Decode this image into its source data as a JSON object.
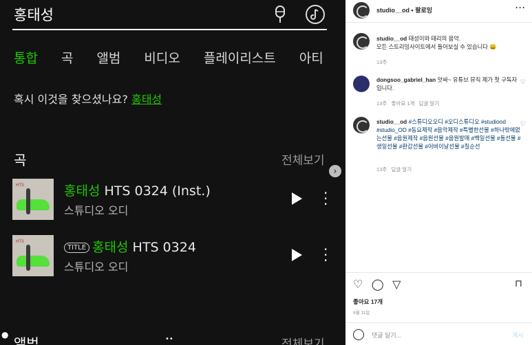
{
  "search": {
    "query": "홍태성"
  },
  "tabs": [
    "통합",
    "곡",
    "앨범",
    "비디오",
    "플레이리스트",
    "아티"
  ],
  "suggestion": {
    "prefix": "혹시 이것을 찾으셨나요?",
    "link": "홍태성"
  },
  "songs_section": {
    "title": "곡",
    "see_all": "전체보기"
  },
  "songs": [
    {
      "badge": "",
      "title_hl": "홍태성",
      "title_rest": " HTS 0324 (Inst.)",
      "artist": "스튜디오 오디"
    },
    {
      "badge": "TITLE",
      "title_hl": "홍태성",
      "title_rest": " HTS 0324",
      "artist": "스튜디오 오디"
    }
  ],
  "albums_section": {
    "title": "앨범",
    "see_all": "전체보기"
  },
  "instagram": {
    "header": {
      "username": "studio__od",
      "dot": "•",
      "follow": "팔로잉",
      "more": "···"
    },
    "caption": {
      "username": "studio__od",
      "text": "태성이와 태리의 음악.",
      "text2": "모든 스트리밍사이트에서 들어보실 수 있습니다 😀",
      "time": "13주"
    },
    "comments": [
      {
        "username": "dongsoo_gabriel_han",
        "text": "앗싸~ 유튜브 뮤직 제가 첫 구독자입니다.",
        "time": "13주",
        "likes": "좋아요 1개",
        "reply": "답글 달기"
      },
      {
        "username": "studio__od",
        "text": "#스튜디오오디 #오디스튜디오 #studiood #studio_OD #동요제작 #음악제작 #특별한선물 #하나밖에없는선물 #음원제작 #음원선물 #음원발매 #백일선물 #돌선물 #생일선물 #환갑선물 #어버이날선물 #칠순선",
        "time": "13주",
        "reply": "답글 달기"
      }
    ],
    "likes": "좋아요 17개",
    "date": "8월 11일",
    "add_comment_placeholder": "댓글 달기...",
    "post_label": "게시"
  },
  "colors": {
    "accent_green": "#1ec800",
    "dark_bg": "#121212",
    "ig_link": "#00376b"
  }
}
